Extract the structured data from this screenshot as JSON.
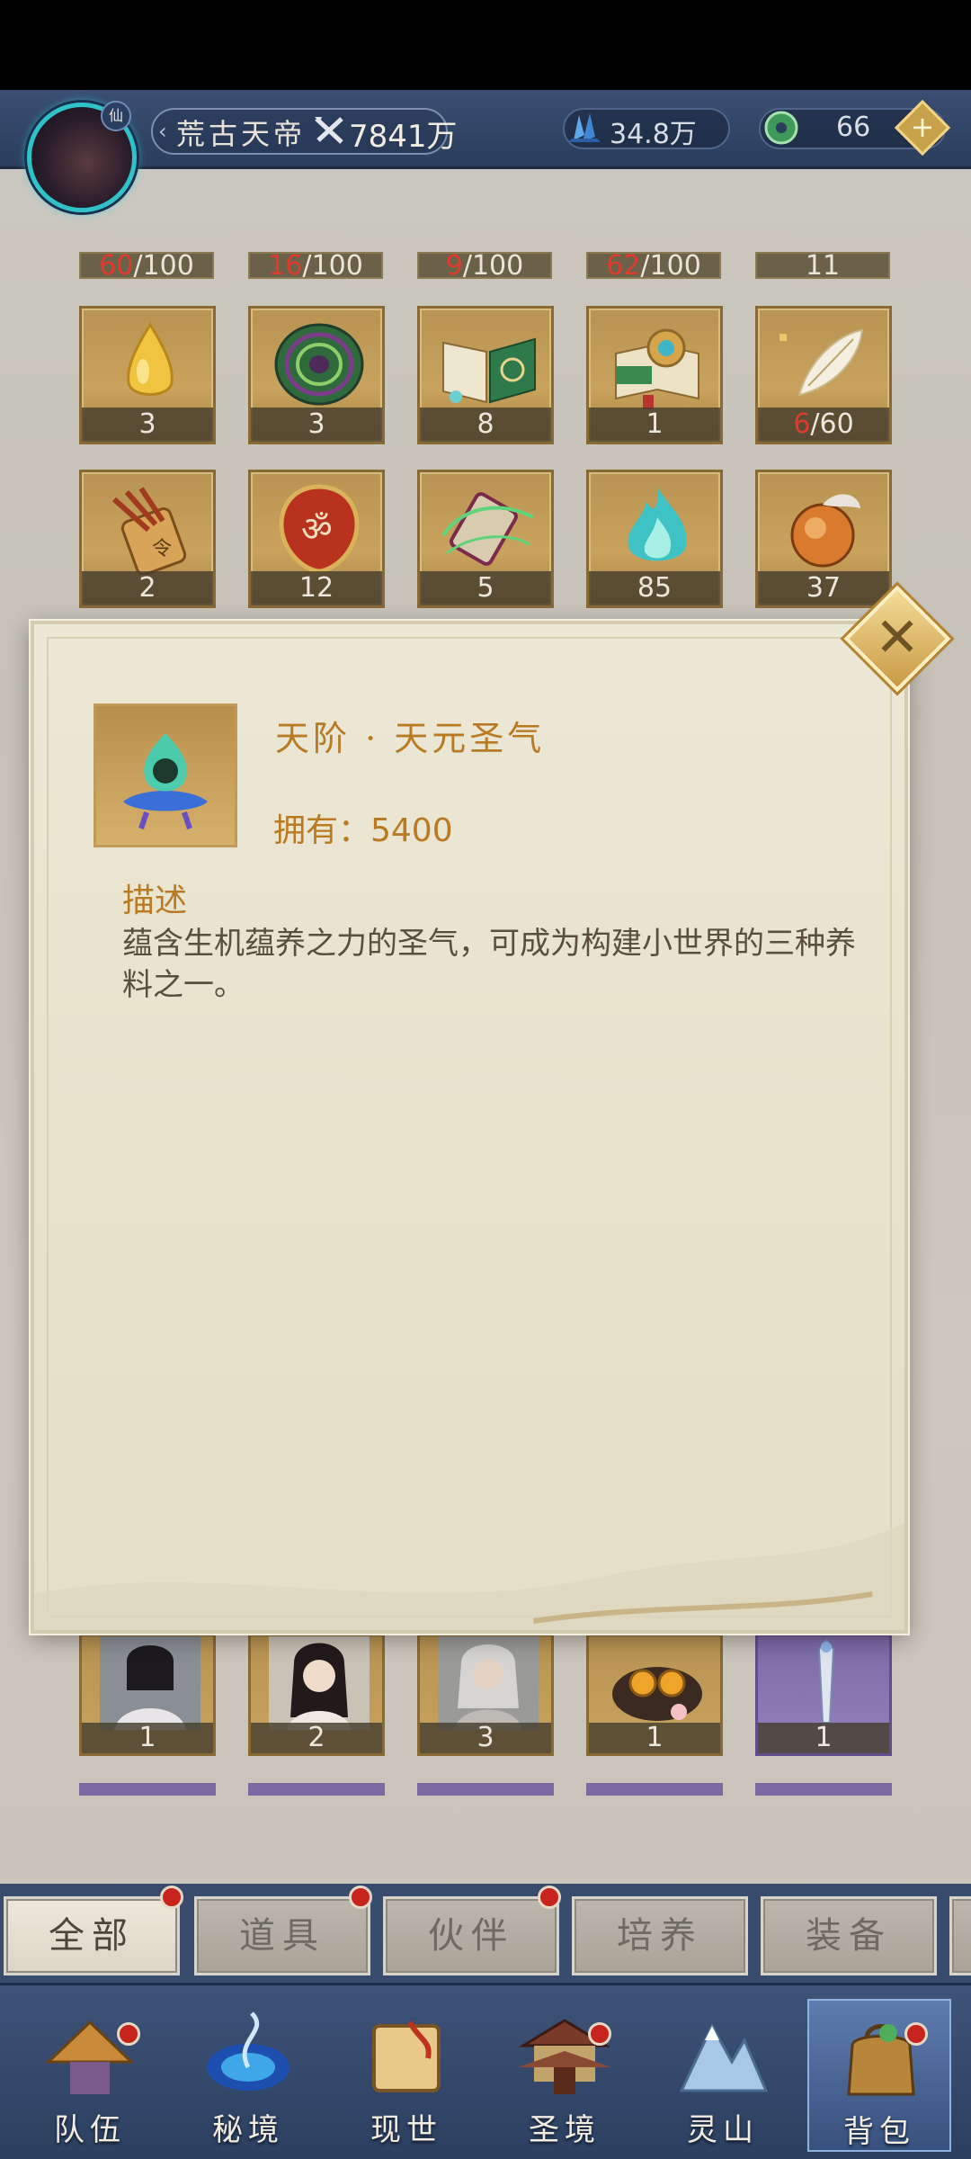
{
  "header": {
    "avatar_badge": "仙",
    "player_name": "荒古天帝",
    "power": "7841万",
    "crystals": "34.8万",
    "jade": "66",
    "add_label": "+"
  },
  "inventory": {
    "top_counts": [
      {
        "have": "60",
        "total": "/100"
      },
      {
        "have": "16",
        "total": "/100"
      },
      {
        "have": "9",
        "total": "/100"
      },
      {
        "have": "62",
        "total": "/100"
      },
      {
        "have": "",
        "total": "11"
      }
    ],
    "row1": [
      {
        "icon": "golden-drop-icon",
        "count": "3"
      },
      {
        "icon": "green-disc-icon",
        "count": "3"
      },
      {
        "icon": "open-book-icon",
        "count": "8"
      },
      {
        "icon": "scroll-orb-icon",
        "count": "1"
      },
      {
        "icon": "jade-feather-icon",
        "count_red": "6",
        "count": "/60"
      }
    ],
    "row2": [
      {
        "icon": "arrow-quiver-icon",
        "count": "2"
      },
      {
        "icon": "rune-seal-icon",
        "count": "12"
      },
      {
        "icon": "wind-scroll-icon",
        "count": "5"
      },
      {
        "icon": "teal-flame-icon",
        "count": "85"
      },
      {
        "icon": "fruit-orb-icon",
        "count": "37"
      }
    ],
    "partners": [
      {
        "icon": "swordsman-portrait-icon",
        "count": "1"
      },
      {
        "icon": "lady-portrait-icon",
        "count": "2"
      },
      {
        "icon": "elder-portrait-icon",
        "count": "3"
      },
      {
        "icon": "treasure-orbs-icon",
        "count": "1"
      },
      {
        "icon": "spirit-sword-icon",
        "count": "1"
      }
    ]
  },
  "detail": {
    "title": "天阶 · 天元圣气",
    "owned": "拥有：5400",
    "desc_heading": "描述",
    "description": "蕴含生机蕴养之力的圣气，可成为构建小世界的三种养料之一。",
    "close_label": "✕"
  },
  "tabs": [
    {
      "label": "全部",
      "active": true
    },
    {
      "label": "道具"
    },
    {
      "label": "伙伴"
    },
    {
      "label": "培养"
    },
    {
      "label": "装备"
    }
  ],
  "nav": [
    {
      "label": "队伍",
      "icon": "hat-icon"
    },
    {
      "label": "秘境",
      "icon": "portal-icon"
    },
    {
      "label": "现世",
      "icon": "scroll-map-icon"
    },
    {
      "label": "圣境",
      "icon": "palace-icon"
    },
    {
      "label": "灵山",
      "icon": "mountain-icon"
    },
    {
      "label": "背包",
      "icon": "bag-icon",
      "active": true
    }
  ],
  "colors": {
    "accent_gold": "#b97a22",
    "red_badge": "#c6241d",
    "nav_blue": "#2c3f60"
  }
}
